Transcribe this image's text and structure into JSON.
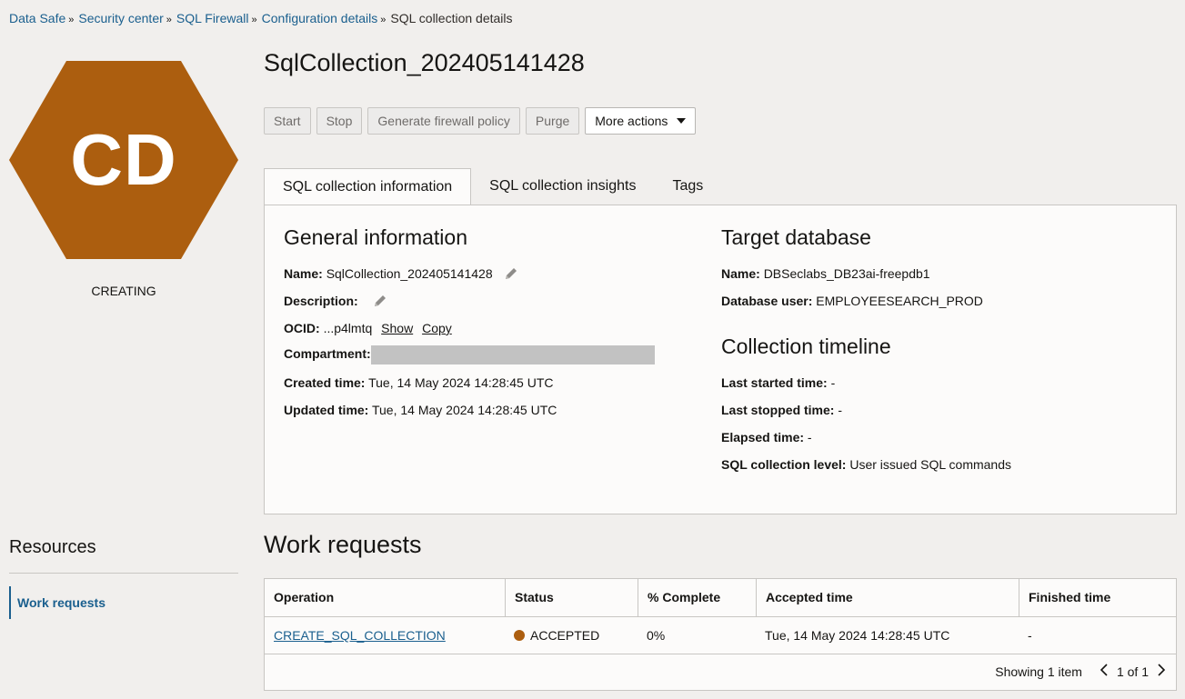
{
  "breadcrumb": {
    "items": [
      "Data Safe",
      "Security center",
      "SQL Firewall",
      "Configuration details"
    ],
    "current": "SQL collection details",
    "separator": "»"
  },
  "resource": {
    "initials": "CD",
    "state": "CREATING",
    "hex_color": "#ac5e0f",
    "title": "SqlCollection_202405141428"
  },
  "actions": {
    "start": "Start",
    "stop": "Stop",
    "generate": "Generate firewall policy",
    "purge": "Purge",
    "more": "More actions"
  },
  "tabs": [
    "SQL collection information",
    "SQL collection insights",
    "Tags"
  ],
  "general": {
    "heading": "General information",
    "name_label": "Name:",
    "name_value": "SqlCollection_202405141428",
    "description_label": "Description:",
    "ocid_label": "OCID:",
    "ocid_value": "...p4lmtq",
    "ocid_show": "Show",
    "ocid_copy": "Copy",
    "compartment_label": "Compartment:",
    "created_label": "Created time:",
    "created_value": "Tue, 14 May 2024 14:28:45 UTC",
    "updated_label": "Updated time:",
    "updated_value": "Tue, 14 May 2024 14:28:45 UTC"
  },
  "target": {
    "heading": "Target database",
    "name_label": "Name:",
    "name_value": "DBSeclabs_DB23ai-freepdb1",
    "user_label": "Database user:",
    "user_value": "EMPLOYEESEARCH_PROD"
  },
  "timeline": {
    "heading": "Collection timeline",
    "started_label": "Last started time:",
    "started_value": "-",
    "stopped_label": "Last stopped time:",
    "stopped_value": "-",
    "elapsed_label": "Elapsed time:",
    "elapsed_value": "-",
    "level_label": "SQL collection level:",
    "level_value": "User issued SQL commands"
  },
  "resources": {
    "heading": "Resources",
    "item": "Work requests"
  },
  "work_requests": {
    "heading": "Work requests",
    "columns": [
      "Operation",
      "Status",
      "% Complete",
      "Accepted time",
      "Finished time"
    ],
    "rows": [
      {
        "operation": "CREATE_SQL_COLLECTION",
        "status": "ACCEPTED",
        "complete": "0%",
        "accepted": "Tue, 14 May 2024 14:28:45 UTC",
        "finished": "-"
      }
    ],
    "showing": "Showing 1 item",
    "page": "1 of 1"
  },
  "colors": {
    "link": "#1a5f8e",
    "accent": "#ac5e0f"
  }
}
